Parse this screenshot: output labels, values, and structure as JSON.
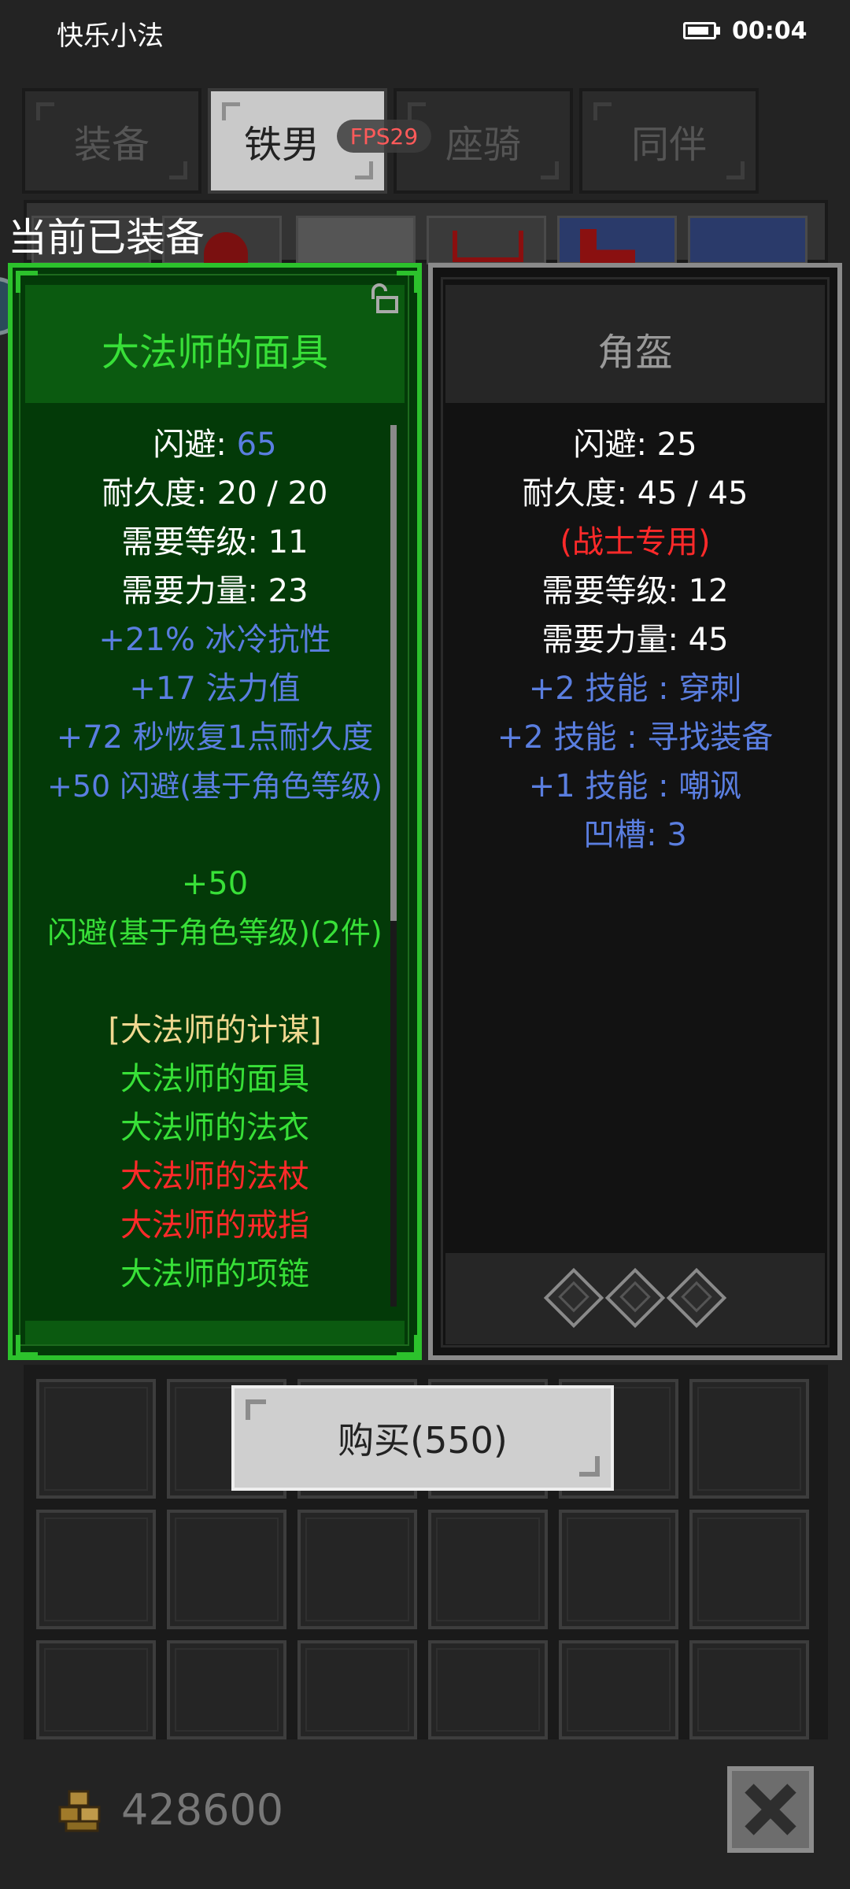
{
  "status_bar": {
    "app_name": "快乐小法",
    "time": "00:04"
  },
  "tabs": [
    {
      "label": "装备",
      "active": false
    },
    {
      "label": "铁男",
      "active": true
    },
    {
      "label": "座骑",
      "active": false
    },
    {
      "label": "同伴",
      "active": false
    }
  ],
  "fps": "FPS29",
  "equipped_label": "当前已装备",
  "left_item": {
    "name": "大法师的面具",
    "lines": [
      {
        "label": "闪避: ",
        "value": "65"
      },
      {
        "text": "耐久度: 20 / 20"
      },
      {
        "text": "需要等级: 11"
      },
      {
        "text": "需要力量: 23"
      },
      {
        "text": "+21% 冰冷抗性"
      },
      {
        "text": "+17 法力值"
      },
      {
        "text": "+72 秒恢复1点耐久度"
      },
      {
        "text": "+50 闪避(基于角色等级)"
      },
      {
        "text": "+50"
      },
      {
        "text": "闪避(基于角色等级)(2件)"
      },
      {
        "text": "[大法师的计谋]"
      },
      {
        "text": "大法师的面具"
      },
      {
        "text": "大法师的法衣"
      },
      {
        "text": "大法师的法杖"
      },
      {
        "text": "大法师的戒指"
      },
      {
        "text": "大法师的项链"
      }
    ]
  },
  "right_item": {
    "name": "角盔",
    "lines": [
      {
        "text": "闪避: 25"
      },
      {
        "text": "耐久度: 45 / 45"
      },
      {
        "text": "(战士专用)"
      },
      {
        "text": "需要等级: 12"
      },
      {
        "text": "需要力量: 45"
      },
      {
        "text": "+2 技能 : 穿刺"
      },
      {
        "text": "+2 技能 : 寻找装备"
      },
      {
        "text": "+1 技能 : 嘲讽"
      },
      {
        "text": "凹槽: 3"
      }
    ],
    "sockets": 3
  },
  "buy_button": "购买(550)",
  "gold": "428600",
  "icons": {
    "gold": "gold-coins-icon",
    "close": "close-icon",
    "lock": "lock-icon"
  },
  "colors": {
    "set_green": "#38e038",
    "magic_blue": "#5a7ee0",
    "warning_red": "#ff2a2a",
    "set_name_gold": "#f0d890"
  }
}
